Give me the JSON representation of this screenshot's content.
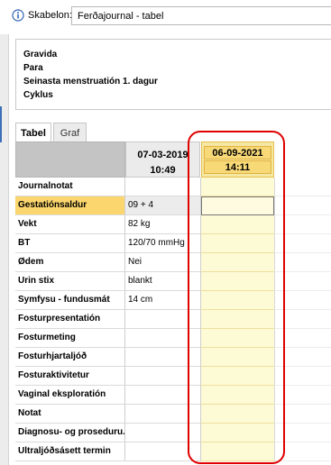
{
  "header": {
    "template_label": "Skabelon:",
    "template_value": "Ferðajournal - tabel"
  },
  "summary": {
    "lines": [
      "Gravida",
      "Para",
      "Seinasta menstruatión 1. dagur",
      "Cyklus"
    ]
  },
  "tabs": [
    {
      "label": "Tabel",
      "active": true
    },
    {
      "label": "Graf",
      "active": false
    }
  ],
  "columns": [
    {
      "date": "07-03-2019",
      "time": "10:49",
      "selected": false
    },
    {
      "date": "06-09-2021",
      "time": "14:11",
      "selected": true
    }
  ],
  "rows": [
    {
      "label": "Journalnotat",
      "v1": "",
      "selected": false
    },
    {
      "label": "Gestatiónsaldur",
      "v1": "09 + 4",
      "selected": true
    },
    {
      "label": "Vekt",
      "v1": "82 kg",
      "selected": false
    },
    {
      "label": "BT",
      "v1": "120/70 mmHg",
      "selected": false
    },
    {
      "label": "Ødem",
      "v1": "Nei",
      "selected": false
    },
    {
      "label": "Urin stix",
      "v1": "blankt",
      "selected": false
    },
    {
      "label": "Symfysu - fundusmát",
      "v1": "14 cm",
      "selected": false
    },
    {
      "label": "Fosturpresentatión",
      "v1": "",
      "selected": false
    },
    {
      "label": "Fosturmeting",
      "v1": "",
      "selected": false
    },
    {
      "label": "Fosturhjartaljóð",
      "v1": "",
      "selected": false
    },
    {
      "label": "Fosturaktivitetur",
      "v1": "",
      "selected": false
    },
    {
      "label": "Vaginal eksploratión",
      "v1": "",
      "selected": false
    },
    {
      "label": "Notat",
      "v1": "",
      "selected": false
    },
    {
      "label": "Diagnosu- og proseduru...",
      "v1": "",
      "selected": false
    },
    {
      "label": "Ultraljóðsásett termin",
      "v1": "",
      "selected": false
    }
  ],
  "colors": {
    "selected_label_bg": "#fbd66e",
    "new_column_bg": "#fdfad6",
    "annotation_ring": "#e00000"
  },
  "icons": {
    "info": "info-circle-icon"
  }
}
